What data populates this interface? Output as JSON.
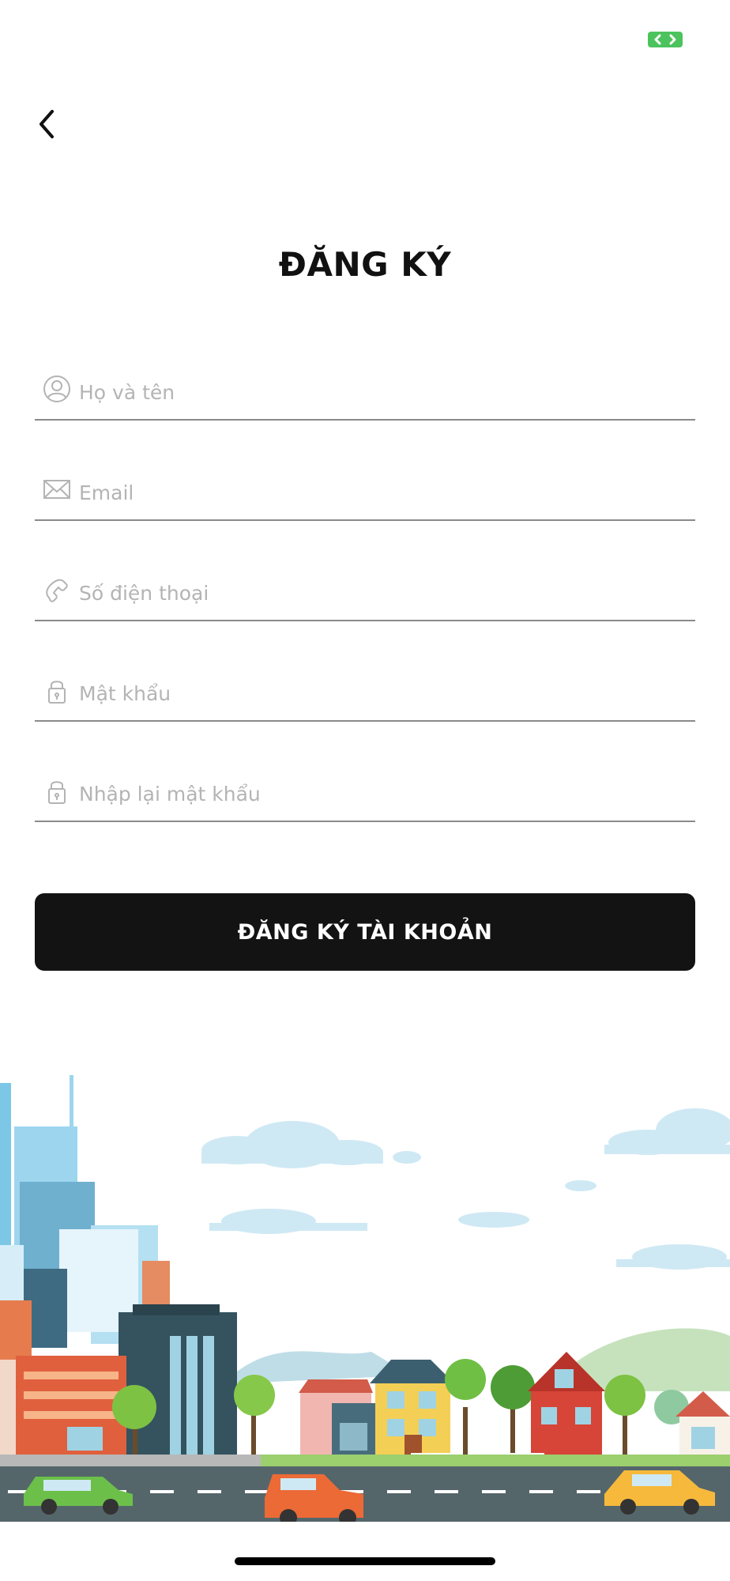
{
  "colors": {
    "background": "#ffffff",
    "button_bg": "#131313",
    "button_text": "#ffffff",
    "placeholder": "#b4b4b4",
    "underline": "#8a8a8a",
    "status_green": "#4cc35c"
  },
  "header": {
    "back_icon": "chevron-left-icon"
  },
  "title": "ĐĂNG KÝ",
  "form": {
    "fields": [
      {
        "name": "full-name",
        "icon": "user-icon",
        "placeholder": "Họ và tên",
        "value": ""
      },
      {
        "name": "email",
        "icon": "mail-icon",
        "placeholder": "Email",
        "value": ""
      },
      {
        "name": "phone",
        "icon": "phone-icon",
        "placeholder": "Số điện thoại",
        "value": ""
      },
      {
        "name": "password",
        "icon": "lock-icon",
        "placeholder": "Mật khẩu",
        "value": ""
      },
      {
        "name": "confirm-password",
        "icon": "lock-icon",
        "placeholder": "Nhập lại mật khẩu",
        "value": ""
      }
    ],
    "submit_label": "ĐĂNG KÝ TÀI KHOẢN"
  },
  "illustration": {
    "name": "city-skyline-illustration"
  }
}
